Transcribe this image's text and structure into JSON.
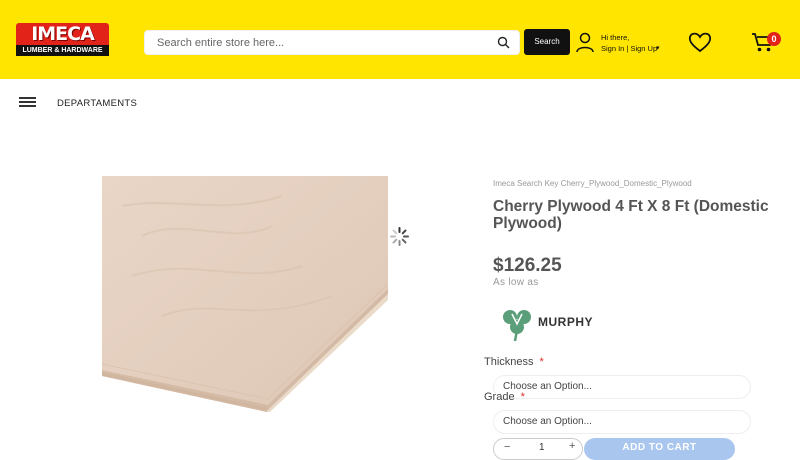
{
  "header": {
    "logo_top": "IMECA",
    "logo_bottom": "LUMBER & HARDWARE",
    "search_placeholder": "Search entire store here...",
    "search_button": "Search",
    "greeting": "Hi there,",
    "signin": "Sign In | Sign Up",
    "cart_count": "0",
    "bg_color": "#ffe500",
    "accent_color": "#e2231a"
  },
  "nav": {
    "departments_label": "DEPARTAMENTS"
  },
  "product": {
    "search_key": "Imeca Search Key  Cherry_Plywood_Domestic_Plywood",
    "title": "Cherry Plywood 4 Ft X 8 Ft (Domestic Plywood)",
    "price": "$126.25",
    "price_note": "As low as",
    "brand": "MURPHY",
    "options": [
      {
        "label": "Thickness",
        "required": "*",
        "placeholder": "Choose an Option..."
      },
      {
        "label": "Grade",
        "required": "*",
        "placeholder": "Choose an Option..."
      }
    ],
    "qty_minus": "−",
    "qty": "1",
    "qty_plus": "+",
    "add_to_cart": "ADD TO CART"
  }
}
